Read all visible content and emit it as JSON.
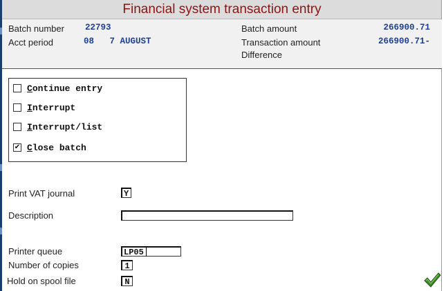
{
  "window": {
    "title": "Financial system transaction entry"
  },
  "header": {
    "batch_number_label": "Batch number",
    "batch_number": "22793",
    "acct_period_label": "Acct period",
    "acct_period": "08   7 AUGUST",
    "batch_amount_label": "Batch amount",
    "batch_amount": "266900.71",
    "transaction_amount_label": "Transaction amount",
    "transaction_amount": "266900.71-",
    "difference_label": "Difference"
  },
  "options": [
    {
      "first": "C",
      "rest": "ontinue entry",
      "checked": false
    },
    {
      "first": "I",
      "rest": "nterrupt",
      "checked": false
    },
    {
      "first": "I",
      "rest": "nterrupt/list",
      "checked": false
    },
    {
      "first": "C",
      "rest": "lose batch",
      "checked": true
    }
  ],
  "form": {
    "print_vat_label": "Print VAT journal",
    "print_vat_value": "Y",
    "description_label": "Description",
    "description_value": "",
    "printer_queue_label": "Printer queue",
    "printer_queue_value": "LP05",
    "copies_label": "Number of copies",
    "copies_value": "1",
    "hold_label": "Hold on spool file",
    "hold_value": "N"
  },
  "ok_button": {
    "icon": "checkmark-icon",
    "color": "#3f8a2c"
  }
}
